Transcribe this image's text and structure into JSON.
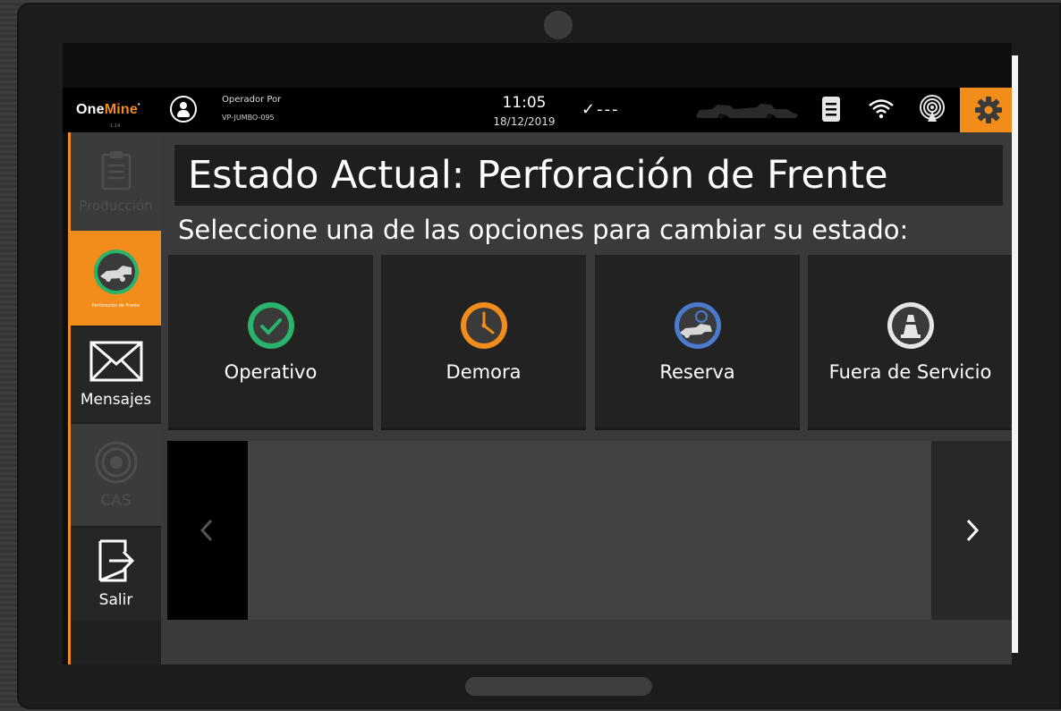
{
  "app": {
    "logo_one": "One",
    "logo_mine": "Mine",
    "logo_mark": "•",
    "version": "1.14"
  },
  "header": {
    "operator_label": "Operador Por",
    "operator_value": "VP-JUMBO-095",
    "time": "11:05",
    "date": "18/12/2019",
    "status_checks": "✓---",
    "icons": [
      "operator-icon",
      "vehicle-icon",
      "document-icon",
      "wifi-icon",
      "radio-signal-icon",
      "gear-icon"
    ]
  },
  "sidebar": {
    "items": [
      {
        "label": "Producción",
        "icon": "clipboard-icon",
        "state": "disabled"
      },
      {
        "label": "Perforación de Frente",
        "icon": "drilling-icon",
        "state": "active"
      },
      {
        "label": "Mensajes",
        "icon": "envelope-icon",
        "state": "normal"
      },
      {
        "label": "CAS",
        "icon": "target-icon",
        "state": "disabled"
      },
      {
        "label": "Salir",
        "icon": "exit-icon",
        "state": "normal"
      }
    ]
  },
  "main": {
    "title_prefix": "Estado Actual:",
    "title_state": "Perforación de Frente",
    "subtitle": "Seleccione una de las opciones para cambiar su estado:",
    "options": [
      {
        "label": "Operativo",
        "icon": "check-circle-icon",
        "color": "#2ab36a"
      },
      {
        "label": "Demora",
        "icon": "clock-icon",
        "color": "#f28c1a"
      },
      {
        "label": "Reserva",
        "icon": "reserve-icon",
        "color": "#4a7bd0"
      },
      {
        "label": "Fuera de Servicio",
        "icon": "cone-icon",
        "color": "#e6e6e6"
      }
    ]
  },
  "colors": {
    "accent": "#f28c1a",
    "background": "#3a3a3a",
    "tile": "#222222"
  }
}
